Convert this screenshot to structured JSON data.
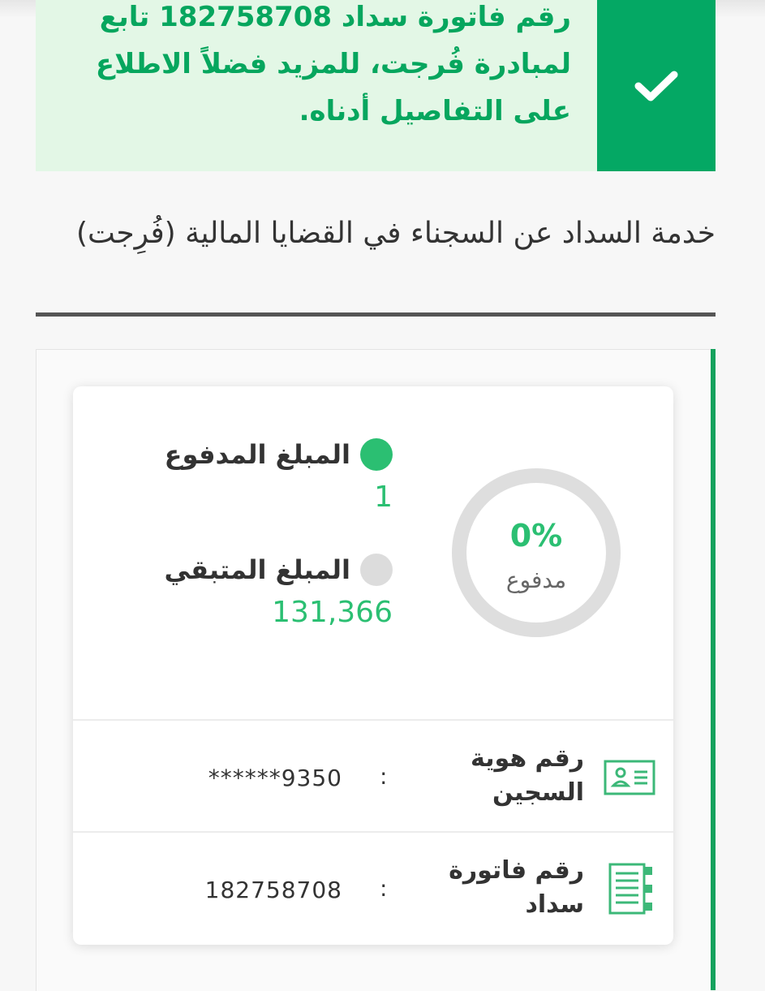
{
  "alert": {
    "message": "رقم فاتورة سداد 182758708 تابع لمبادرة فُرجت، للمزيد فضلاً الاطلاع على التفاصيل أدناه.",
    "icon": "check-icon",
    "colors": {
      "background": "#e3f7e6",
      "icon_box": "#04a864",
      "text": "#06a65e"
    }
  },
  "page": {
    "title": "خدمة السداد عن السجناء في القضايا المالية (فُرِجت)"
  },
  "summary": {
    "percent_paid": "0%",
    "percent_label": "مدفوع",
    "paid": {
      "label": "المبلغ المدفوع",
      "value": "1",
      "color": "#2bbf72"
    },
    "remaining": {
      "label": "المبلغ المتبقي",
      "value": "131,366",
      "color": "#dcdcdc"
    }
  },
  "details": [
    {
      "label": "رقم هوية السجين",
      "value": "******9350",
      "icon": "id-card-icon"
    },
    {
      "label": "رقم فاتورة سداد",
      "value": "182758708",
      "icon": "invoice-icon"
    }
  ],
  "colon": ":"
}
